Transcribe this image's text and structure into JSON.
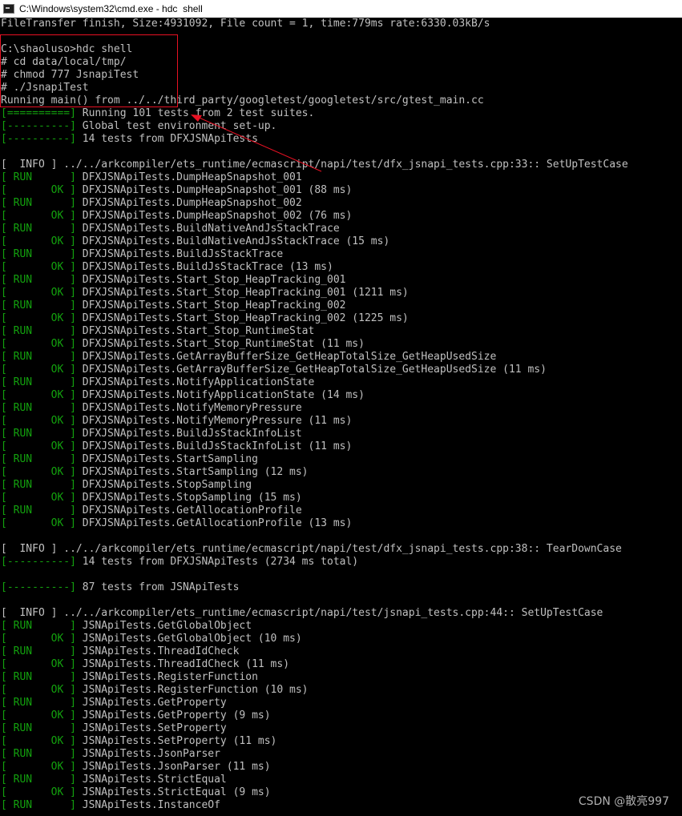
{
  "window": {
    "title": "C:\\Windows\\system32\\cmd.exe - hdc  shell"
  },
  "console_lines": [
    {
      "tag": "",
      "type": "plain",
      "text": "FileTransfer finish, Size:4931092, File count = 1, time:779ms rate:6330.03kB/s"
    },
    {
      "tag": "",
      "type": "plain",
      "text": ""
    },
    {
      "tag": "",
      "type": "plain",
      "text": "C:\\shaoluso>hdc shell"
    },
    {
      "tag": "",
      "type": "plain",
      "text": "# cd data/local/tmp/"
    },
    {
      "tag": "",
      "type": "plain",
      "text": "# chmod 777 JsnapiTest"
    },
    {
      "tag": "",
      "type": "plain",
      "text": "# ./JsnapiTest"
    },
    {
      "tag": "",
      "type": "plain",
      "text": "Running main() from ../../third_party/googletest/googletest/src/gtest_main.cc"
    },
    {
      "tag": "[==========]",
      "type": "sep",
      "text": " Running 101 tests from 2 test suites."
    },
    {
      "tag": "[----------]",
      "type": "sep",
      "text": " Global test environment set-up."
    },
    {
      "tag": "[----------]",
      "type": "sep",
      "text": " 14 tests from DFXJSNApiTests"
    },
    {
      "tag": "",
      "type": "plain",
      "text": ""
    },
    {
      "tag": "[  INFO ]",
      "type": "info",
      "text": " ../../arkcompiler/ets_runtime/ecmascript/napi/test/dfx_jsnapi_tests.cpp:33:: SetUpTestCase"
    },
    {
      "tag": "[ RUN      ]",
      "type": "run",
      "text": " DFXJSNApiTests.DumpHeapSnapshot_001"
    },
    {
      "tag": "[       OK ]",
      "type": "ok",
      "text": " DFXJSNApiTests.DumpHeapSnapshot_001 (88 ms)"
    },
    {
      "tag": "[ RUN      ]",
      "type": "run",
      "text": " DFXJSNApiTests.DumpHeapSnapshot_002"
    },
    {
      "tag": "[       OK ]",
      "type": "ok",
      "text": " DFXJSNApiTests.DumpHeapSnapshot_002 (76 ms)"
    },
    {
      "tag": "[ RUN      ]",
      "type": "run",
      "text": " DFXJSNApiTests.BuildNativeAndJsStackTrace"
    },
    {
      "tag": "[       OK ]",
      "type": "ok",
      "text": " DFXJSNApiTests.BuildNativeAndJsStackTrace (15 ms)"
    },
    {
      "tag": "[ RUN      ]",
      "type": "run",
      "text": " DFXJSNApiTests.BuildJsStackTrace"
    },
    {
      "tag": "[       OK ]",
      "type": "ok",
      "text": " DFXJSNApiTests.BuildJsStackTrace (13 ms)"
    },
    {
      "tag": "[ RUN      ]",
      "type": "run",
      "text": " DFXJSNApiTests.Start_Stop_HeapTracking_001"
    },
    {
      "tag": "[       OK ]",
      "type": "ok",
      "text": " DFXJSNApiTests.Start_Stop_HeapTracking_001 (1211 ms)"
    },
    {
      "tag": "[ RUN      ]",
      "type": "run",
      "text": " DFXJSNApiTests.Start_Stop_HeapTracking_002"
    },
    {
      "tag": "[       OK ]",
      "type": "ok",
      "text": " DFXJSNApiTests.Start_Stop_HeapTracking_002 (1225 ms)"
    },
    {
      "tag": "[ RUN      ]",
      "type": "run",
      "text": " DFXJSNApiTests.Start_Stop_RuntimeStat"
    },
    {
      "tag": "[       OK ]",
      "type": "ok",
      "text": " DFXJSNApiTests.Start_Stop_RuntimeStat (11 ms)"
    },
    {
      "tag": "[ RUN      ]",
      "type": "run",
      "text": " DFXJSNApiTests.GetArrayBufferSize_GetHeapTotalSize_GetHeapUsedSize"
    },
    {
      "tag": "[       OK ]",
      "type": "ok",
      "text": " DFXJSNApiTests.GetArrayBufferSize_GetHeapTotalSize_GetHeapUsedSize (11 ms)"
    },
    {
      "tag": "[ RUN      ]",
      "type": "run",
      "text": " DFXJSNApiTests.NotifyApplicationState"
    },
    {
      "tag": "[       OK ]",
      "type": "ok",
      "text": " DFXJSNApiTests.NotifyApplicationState (14 ms)"
    },
    {
      "tag": "[ RUN      ]",
      "type": "run",
      "text": " DFXJSNApiTests.NotifyMemoryPressure"
    },
    {
      "tag": "[       OK ]",
      "type": "ok",
      "text": " DFXJSNApiTests.NotifyMemoryPressure (11 ms)"
    },
    {
      "tag": "[ RUN      ]",
      "type": "run",
      "text": " DFXJSNApiTests.BuildJsStackInfoList"
    },
    {
      "tag": "[       OK ]",
      "type": "ok",
      "text": " DFXJSNApiTests.BuildJsStackInfoList (11 ms)"
    },
    {
      "tag": "[ RUN      ]",
      "type": "run",
      "text": " DFXJSNApiTests.StartSampling"
    },
    {
      "tag": "[       OK ]",
      "type": "ok",
      "text": " DFXJSNApiTests.StartSampling (12 ms)"
    },
    {
      "tag": "[ RUN      ]",
      "type": "run",
      "text": " DFXJSNApiTests.StopSampling"
    },
    {
      "tag": "[       OK ]",
      "type": "ok",
      "text": " DFXJSNApiTests.StopSampling (15 ms)"
    },
    {
      "tag": "[ RUN      ]",
      "type": "run",
      "text": " DFXJSNApiTests.GetAllocationProfile"
    },
    {
      "tag": "[       OK ]",
      "type": "ok",
      "text": " DFXJSNApiTests.GetAllocationProfile (13 ms)"
    },
    {
      "tag": "",
      "type": "plain",
      "text": ""
    },
    {
      "tag": "[  INFO ]",
      "type": "info",
      "text": " ../../arkcompiler/ets_runtime/ecmascript/napi/test/dfx_jsnapi_tests.cpp:38:: TearDownCase"
    },
    {
      "tag": "[----------]",
      "type": "sep",
      "text": " 14 tests from DFXJSNApiTests (2734 ms total)"
    },
    {
      "tag": "",
      "type": "plain",
      "text": ""
    },
    {
      "tag": "[----------]",
      "type": "sep",
      "text": " 87 tests from JSNApiTests"
    },
    {
      "tag": "",
      "type": "plain",
      "text": ""
    },
    {
      "tag": "[  INFO ]",
      "type": "info",
      "text": " ../../arkcompiler/ets_runtime/ecmascript/napi/test/jsnapi_tests.cpp:44:: SetUpTestCase"
    },
    {
      "tag": "[ RUN      ]",
      "type": "run",
      "text": " JSNApiTests.GetGlobalObject"
    },
    {
      "tag": "[       OK ]",
      "type": "ok",
      "text": " JSNApiTests.GetGlobalObject (10 ms)"
    },
    {
      "tag": "[ RUN      ]",
      "type": "run",
      "text": " JSNApiTests.ThreadIdCheck"
    },
    {
      "tag": "[       OK ]",
      "type": "ok",
      "text": " JSNApiTests.ThreadIdCheck (11 ms)"
    },
    {
      "tag": "[ RUN      ]",
      "type": "run",
      "text": " JSNApiTests.RegisterFunction"
    },
    {
      "tag": "[       OK ]",
      "type": "ok",
      "text": " JSNApiTests.RegisterFunction (10 ms)"
    },
    {
      "tag": "[ RUN      ]",
      "type": "run",
      "text": " JSNApiTests.GetProperty"
    },
    {
      "tag": "[       OK ]",
      "type": "ok",
      "text": " JSNApiTests.GetProperty (9 ms)"
    },
    {
      "tag": "[ RUN      ]",
      "type": "run",
      "text": " JSNApiTests.SetProperty"
    },
    {
      "tag": "[       OK ]",
      "type": "ok",
      "text": " JSNApiTests.SetProperty (11 ms)"
    },
    {
      "tag": "[ RUN      ]",
      "type": "run",
      "text": " JSNApiTests.JsonParser"
    },
    {
      "tag": "[       OK ]",
      "type": "ok",
      "text": " JSNApiTests.JsonParser (11 ms)"
    },
    {
      "tag": "[ RUN      ]",
      "type": "run",
      "text": " JSNApiTests.StrictEqual"
    },
    {
      "tag": "[       OK ]",
      "type": "ok",
      "text": " JSNApiTests.StrictEqual (9 ms)"
    },
    {
      "tag": "[ RUN      ]",
      "type": "run",
      "text": " JSNApiTests.InstanceOf"
    }
  ],
  "watermark": "CSDN @散亮997",
  "colors": {
    "console_bg": "#000000",
    "console_text": "#c0c0c0",
    "status_green": "#13a10e",
    "annotation_red": "#e81123"
  }
}
